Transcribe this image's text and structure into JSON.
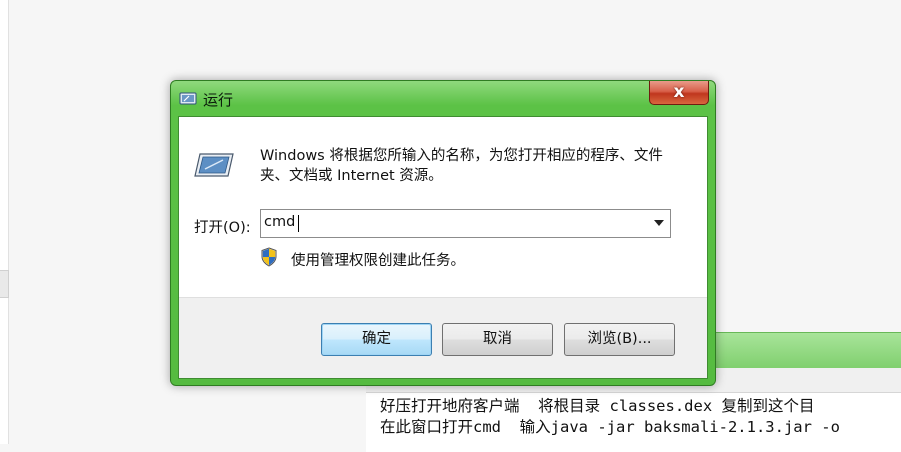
{
  "background": {
    "lines": [
      "好压打开地府客户端  将根目录 classes.dex 复制到这个目",
      "在此窗口打开cmd  输入java -jar baksmali-2.1.3.jar -o"
    ]
  },
  "dialog": {
    "title": "运行",
    "close_label": "x",
    "description": "Windows 将根据您所输入的名称，为您打开相应的程序、文件夹、文档或 Internet 资源。",
    "open_label": "打开(O):",
    "open_value": "cmd",
    "admin_note": "使用管理权限创建此任务。",
    "buttons": {
      "ok": "确定",
      "cancel": "取消",
      "browse": "浏览(B)..."
    }
  },
  "colors": {
    "frame_green": "#55bb40",
    "close_red": "#c0361e",
    "default_button_border": "#3c7fb1"
  }
}
